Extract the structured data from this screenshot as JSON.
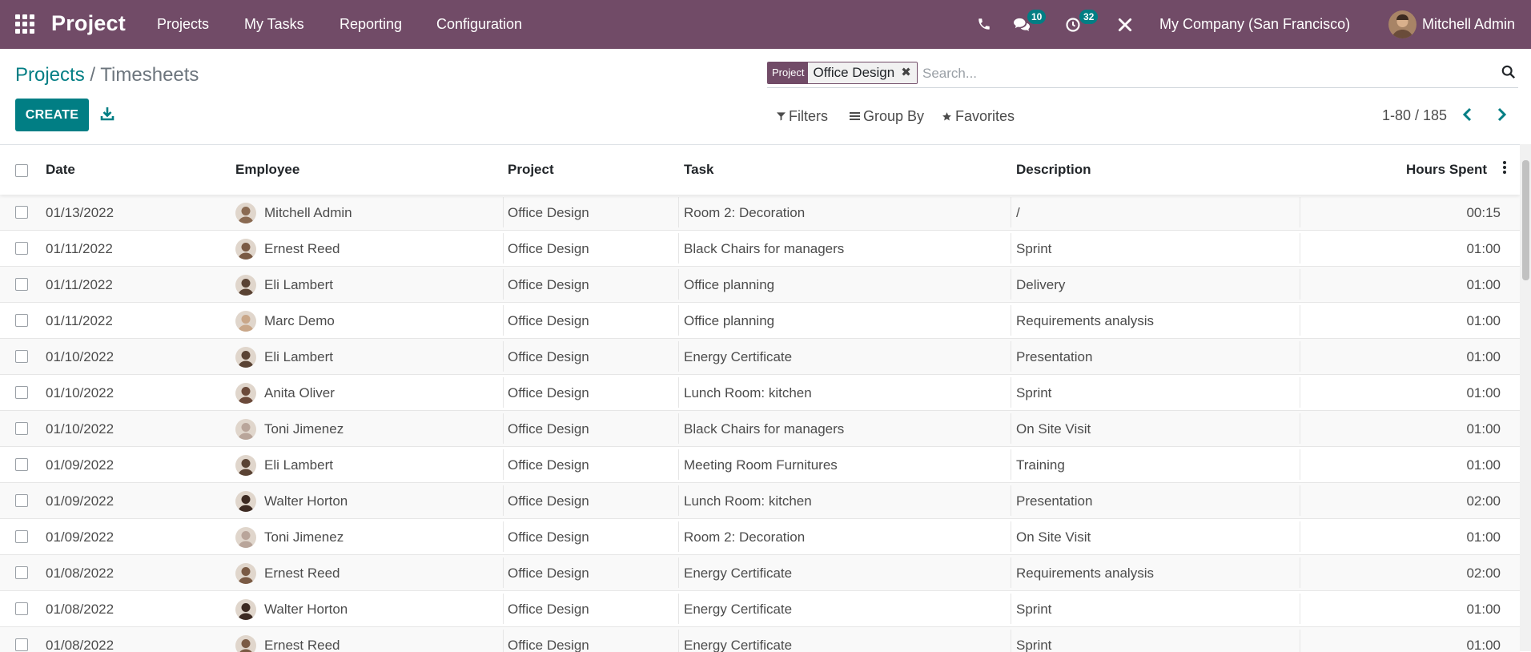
{
  "navbar": {
    "brand": "Project",
    "menu": [
      "Projects",
      "My Tasks",
      "Reporting",
      "Configuration"
    ],
    "messages_count": "10",
    "activities_count": "32",
    "company": "My Company (San Francisco)",
    "user": "Mitchell Admin",
    "colors": {
      "bar": "#714b67",
      "badge": "#017e84"
    }
  },
  "breadcrumb": {
    "parent": "Projects",
    "separator": "/",
    "current": "Timesheets"
  },
  "toolbar": {
    "create_label": "CREATE"
  },
  "search": {
    "facet_label": "Project",
    "facet_value": "Office Design",
    "placeholder": "Search..."
  },
  "controls": {
    "filters": "Filters",
    "group_by": "Group By",
    "favorites": "Favorites"
  },
  "pager": {
    "range": "1-80 / 185"
  },
  "table": {
    "headers": {
      "date": "Date",
      "employee": "Employee",
      "project": "Project",
      "task": "Task",
      "description": "Description",
      "hours": "Hours Spent"
    },
    "rows": [
      {
        "date": "01/13/2022",
        "employee": "Mitchell Admin",
        "project": "Office Design",
        "task": "Room 2: Decoration",
        "description": "/",
        "hours": "00:15",
        "avatar": "#8a6a52"
      },
      {
        "date": "01/11/2022",
        "employee": "Ernest Reed",
        "project": "Office Design",
        "task": "Black Chairs for managers",
        "description": "Sprint",
        "hours": "01:00",
        "avatar": "#7a5a44"
      },
      {
        "date": "01/11/2022",
        "employee": "Eli Lambert",
        "project": "Office Design",
        "task": "Office planning",
        "description": "Delivery",
        "hours": "01:00",
        "avatar": "#5a4334"
      },
      {
        "date": "01/11/2022",
        "employee": "Marc Demo",
        "project": "Office Design",
        "task": "Office planning",
        "description": "Requirements analysis",
        "hours": "01:00",
        "avatar": "#c9a789"
      },
      {
        "date": "01/10/2022",
        "employee": "Eli Lambert",
        "project": "Office Design",
        "task": "Energy Certificate",
        "description": "Presentation",
        "hours": "01:00",
        "avatar": "#5a4334"
      },
      {
        "date": "01/10/2022",
        "employee": "Anita Oliver",
        "project": "Office Design",
        "task": "Lunch Room: kitchen",
        "description": "Sprint",
        "hours": "01:00",
        "avatar": "#6b4a3a"
      },
      {
        "date": "01/10/2022",
        "employee": "Toni Jimenez",
        "project": "Office Design",
        "task": "Black Chairs for managers",
        "description": "On Site Visit",
        "hours": "01:00",
        "avatar": "#b9a59a"
      },
      {
        "date": "01/09/2022",
        "employee": "Eli Lambert",
        "project": "Office Design",
        "task": "Meeting Room Furnitures",
        "description": "Training",
        "hours": "01:00",
        "avatar": "#5a4334"
      },
      {
        "date": "01/09/2022",
        "employee": "Walter Horton",
        "project": "Office Design",
        "task": "Lunch Room: kitchen",
        "description": "Presentation",
        "hours": "02:00",
        "avatar": "#3d2a22"
      },
      {
        "date": "01/09/2022",
        "employee": "Toni Jimenez",
        "project": "Office Design",
        "task": "Room 2: Decoration",
        "description": "On Site Visit",
        "hours": "01:00",
        "avatar": "#b9a59a"
      },
      {
        "date": "01/08/2022",
        "employee": "Ernest Reed",
        "project": "Office Design",
        "task": "Energy Certificate",
        "description": "Requirements analysis",
        "hours": "02:00",
        "avatar": "#7a5a44"
      },
      {
        "date": "01/08/2022",
        "employee": "Walter Horton",
        "project": "Office Design",
        "task": "Energy Certificate",
        "description": "Sprint",
        "hours": "01:00",
        "avatar": "#3d2a22"
      },
      {
        "date": "01/08/2022",
        "employee": "Ernest Reed",
        "project": "Office Design",
        "task": "Energy Certificate",
        "description": "Sprint",
        "hours": "01:00",
        "avatar": "#7a5a44"
      }
    ]
  }
}
